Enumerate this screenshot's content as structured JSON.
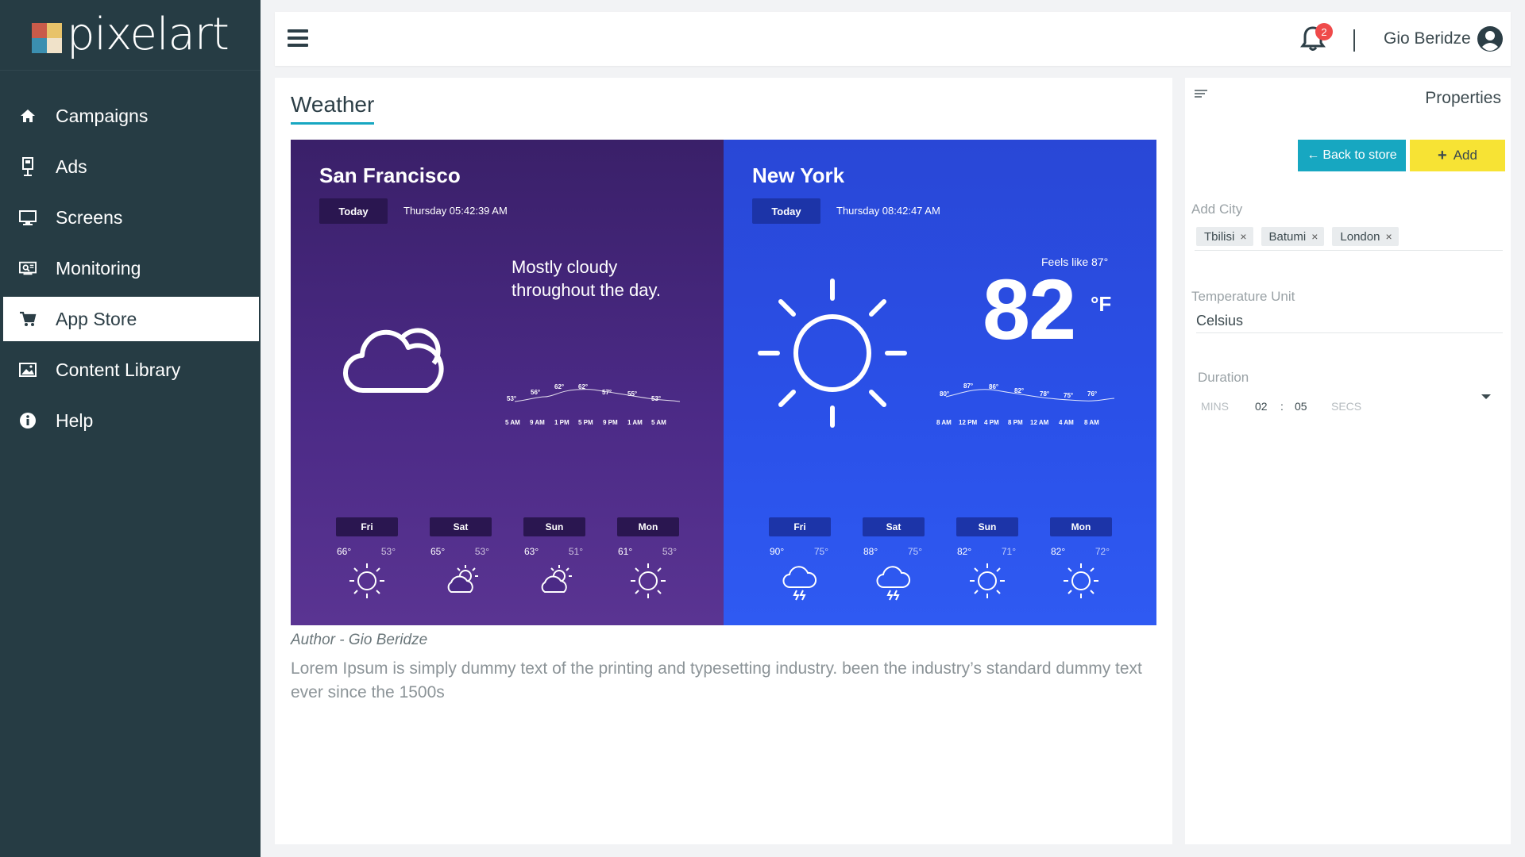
{
  "app": {
    "brand": "pixelart"
  },
  "sidebar": {
    "items": [
      {
        "label": "Campaigns",
        "icon": "home-icon"
      },
      {
        "label": "Ads",
        "icon": "ad-board-icon"
      },
      {
        "label": "Screens",
        "icon": "monitor-icon"
      },
      {
        "label": "Monitoring",
        "icon": "monitoring-icon"
      },
      {
        "label": "App Store",
        "icon": "cart-icon",
        "active": true
      },
      {
        "label": "Content Library",
        "icon": "image-icon"
      },
      {
        "label": "Help",
        "icon": "info-icon"
      }
    ]
  },
  "topbar": {
    "notification_count": "2",
    "user_name": "Gio Beridze"
  },
  "main": {
    "title": "Weather",
    "author": "Author - Gio Beridze",
    "description": "Lorem Ipsum is simply dummy text of the printing and typesetting industry.  been the industry’s standard dummy text ever since the 1500s"
  },
  "weather": {
    "sf": {
      "city": "San Francisco",
      "today": "Today",
      "datetime": "Thursday 05:42:39 AM",
      "summary": "Mostly cloudy throughout the day.",
      "hourly_temps": [
        "53°",
        "56°",
        "62°",
        "62°",
        "57°",
        "55°",
        "53°"
      ],
      "hourly_labels": [
        "5 AM",
        "9 AM",
        "1 PM",
        "5 PM",
        "9 PM",
        "1 AM",
        "5 AM"
      ],
      "days": [
        {
          "day": "Fri",
          "hi": "66°",
          "lo": "53°",
          "icon": "sun-icon"
        },
        {
          "day": "Sat",
          "hi": "65°",
          "lo": "53°",
          "icon": "partly-cloudy-icon"
        },
        {
          "day": "Sun",
          "hi": "63°",
          "lo": "51°",
          "icon": "partly-cloudy-icon"
        },
        {
          "day": "Mon",
          "hi": "61°",
          "lo": "53°",
          "icon": "sun-icon"
        }
      ]
    },
    "ny": {
      "city": "New York",
      "today": "Today",
      "datetime": "Thursday 08:42:47 AM",
      "feels_like": "Feels like 87°",
      "temperature": "82",
      "unit": "°F",
      "hourly_temps": [
        "80°",
        "87°",
        "86°",
        "82°",
        "78°",
        "75°",
        "76°"
      ],
      "hourly_labels": [
        "8 AM",
        "12 PM",
        "4 PM",
        "8 PM",
        "12 AM",
        "4 AM",
        "8 AM"
      ],
      "days": [
        {
          "day": "Fri",
          "hi": "90°",
          "lo": "75°",
          "icon": "thunderstorm-icon"
        },
        {
          "day": "Sat",
          "hi": "88°",
          "lo": "75°",
          "icon": "thunderstorm-icon"
        },
        {
          "day": "Sun",
          "hi": "82°",
          "lo": "71°",
          "icon": "sun-icon"
        },
        {
          "day": "Mon",
          "hi": "82°",
          "lo": "72°",
          "icon": "sun-icon"
        }
      ]
    }
  },
  "properties": {
    "title": "Properties",
    "back_label": "Back to store",
    "add_label": "Add",
    "add_city_label": "Add City",
    "cities": [
      "Tbilisi",
      "Batumi",
      "London"
    ],
    "temp_unit_label": "Temperature Unit",
    "temp_unit_value": "Celsius",
    "duration_label": "Duration",
    "mins_label": "MINS",
    "mins_value": "02",
    "separator": ":",
    "secs_value": "05",
    "secs_label": "SECS"
  },
  "colors": {
    "sidebar_bg": "#263c44",
    "accent_teal": "#17a7c1",
    "accent_yellow": "#f7e334",
    "sf_panel": "#4b2a86",
    "ny_panel": "#2a50e8",
    "badge_red": "#ef4a4a"
  }
}
